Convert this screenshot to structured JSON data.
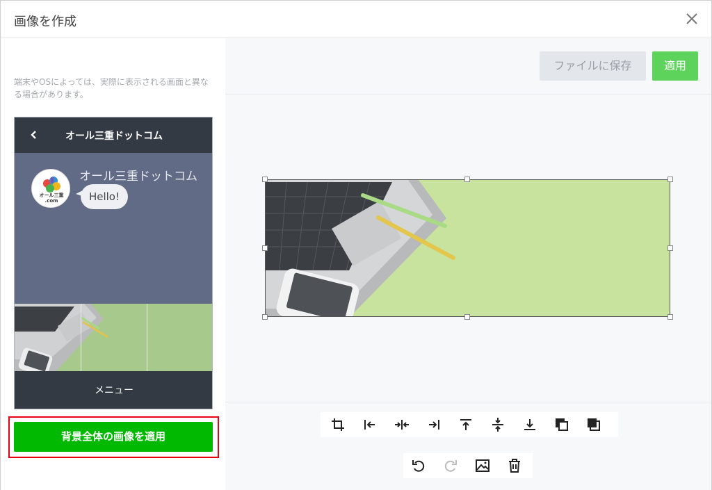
{
  "modal": {
    "title": "画像を作成"
  },
  "left": {
    "note": "端末やOSによっては、実際に表示される画面と異なる場合があります。",
    "preview": {
      "header_title": "オール三重ドットコム",
      "avatar_text_1": "オール三重",
      "avatar_text_2": ".com",
      "chat_name": "オール三重ドットコム",
      "bubble_text": "Hello!",
      "menu_label": "メニュー"
    },
    "apply_all_label": "背景全体の画像を適用"
  },
  "right": {
    "save_file_label": "ファイルに保存",
    "apply_label": "適用"
  },
  "colors": {
    "accent_green": "#00b900",
    "apply_green": "#5dd35b",
    "highlight_red": "#e60012",
    "phone_bg": "#616b86",
    "image_green": "#c7e39e"
  },
  "icons": {
    "toolbar": [
      "crop-icon",
      "align-left-icon",
      "align-center-horizontal-icon",
      "align-right-icon",
      "align-top-icon",
      "align-center-vertical-icon",
      "align-bottom-icon",
      "send-backward-icon",
      "bring-forward-icon"
    ],
    "toolbar2": [
      "undo-icon",
      "redo-icon",
      "image-icon",
      "trash-icon"
    ]
  }
}
